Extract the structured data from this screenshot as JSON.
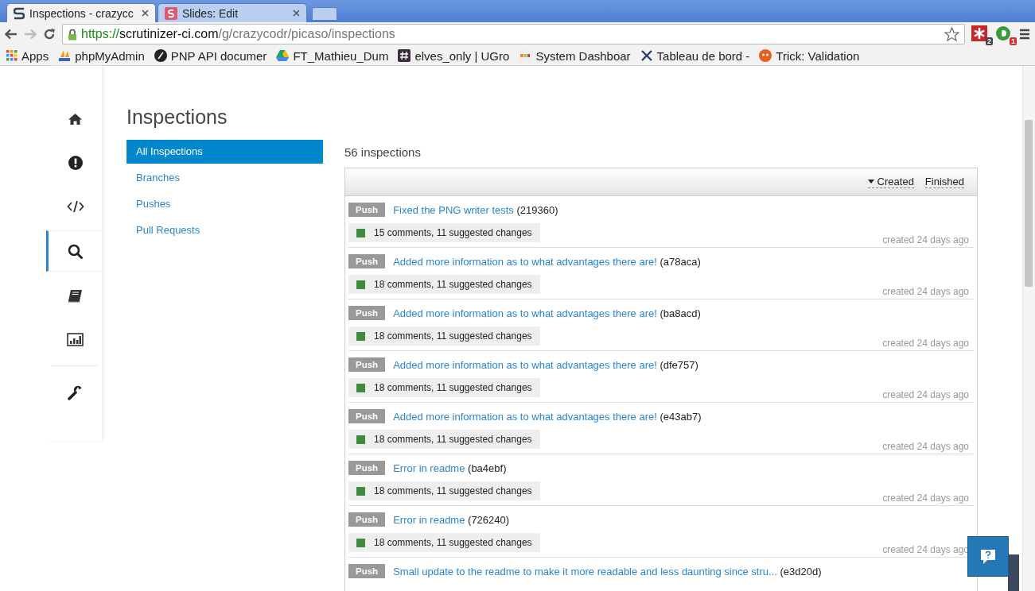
{
  "browser": {
    "tabs": [
      {
        "title": "Inspections - crazycc",
        "selected": true
      },
      {
        "title": "Slides: Edit",
        "selected": false
      }
    ],
    "url": {
      "scheme": "https://",
      "host": "scrutinizer-ci.com",
      "path": "/g/crazycodr/picaso/inspections"
    },
    "extensions": [
      {
        "badge": "2"
      },
      {
        "badge": "1"
      }
    ],
    "bookmarks": [
      {
        "label": "Apps"
      },
      {
        "label": "phpMyAdmin"
      },
      {
        "label": "PNP API documer"
      },
      {
        "label": "FT_Mathieu_Dum"
      },
      {
        "label": "elves_only | UGro"
      },
      {
        "label": "System Dashboar"
      },
      {
        "label": "Tableau de bord -"
      },
      {
        "label": "Trick: Validation"
      }
    ]
  },
  "sidebar": {
    "items": [
      {
        "selected": false
      },
      {
        "selected": false
      },
      {
        "selected": false
      },
      {
        "selected": true
      },
      {
        "selected": false
      },
      {
        "selected": false
      },
      {
        "selected": false
      }
    ]
  },
  "page": {
    "title": "Inspections",
    "nav": [
      {
        "label": "All Inspections",
        "selected": true
      },
      {
        "label": "Branches",
        "selected": false
      },
      {
        "label": "Pushes",
        "selected": false
      },
      {
        "label": "Pull Requests",
        "selected": false
      }
    ],
    "count": "56 inspections",
    "sort": [
      {
        "label": "Created",
        "selected": true
      },
      {
        "label": "Finished",
        "selected": false
      }
    ],
    "inspections": [
      {
        "type": "Push",
        "title": "Fixed the PNG writer tests",
        "ref": "(219360)",
        "stats": "15 comments, 11 suggested changes",
        "created": "created 24 days ago"
      },
      {
        "type": "Push",
        "title": "Added more information as to what advantages there are!",
        "ref": "(a78aca)",
        "stats": "18 comments, 11 suggested changes",
        "created": "created 24 days ago"
      },
      {
        "type": "Push",
        "title": "Added more information as to what advantages there are!",
        "ref": "(ba8acd)",
        "stats": "18 comments, 11 suggested changes",
        "created": "created 24 days ago"
      },
      {
        "type": "Push",
        "title": "Added more information as to what advantages there are!",
        "ref": "(dfe757)",
        "stats": "18 comments, 11 suggested changes",
        "created": "created 24 days ago"
      },
      {
        "type": "Push",
        "title": "Added more information as to what advantages there are!",
        "ref": "(e43ab7)",
        "stats": "18 comments, 11 suggested changes",
        "created": "created 24 days ago"
      },
      {
        "type": "Push",
        "title": "Error in readme",
        "ref": "(ba4ebf)",
        "stats": "18 comments, 11 suggested changes",
        "created": "created 24 days ago"
      },
      {
        "type": "Push",
        "title": "Error in readme",
        "ref": "(726240)",
        "stats": "18 comments, 11 suggested changes",
        "created": "created 24 days ago"
      },
      {
        "type": "Push",
        "title": "Small update to the readme to make it more readable and less daunting since stru...",
        "ref": "(e3d20d)"
      }
    ]
  }
}
